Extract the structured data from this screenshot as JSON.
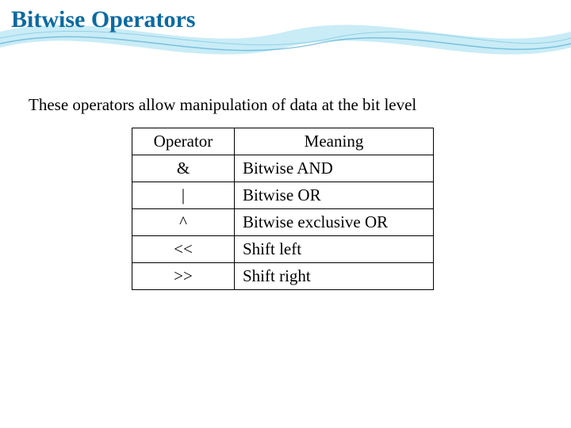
{
  "title": "Bitwise Operators",
  "intro": "These operators allow manipulation of data at the bit level",
  "table": {
    "headers": {
      "operator": "Operator",
      "meaning": "Meaning"
    },
    "rows": [
      {
        "operator": "&",
        "meaning": "Bitwise AND"
      },
      {
        "operator": "|",
        "meaning": "Bitwise OR"
      },
      {
        "operator": "^",
        "meaning": "Bitwise exclusive OR"
      },
      {
        "operator": "<<",
        "meaning": "Shift left"
      },
      {
        "operator": ">>",
        "meaning": "Shift right"
      }
    ]
  }
}
